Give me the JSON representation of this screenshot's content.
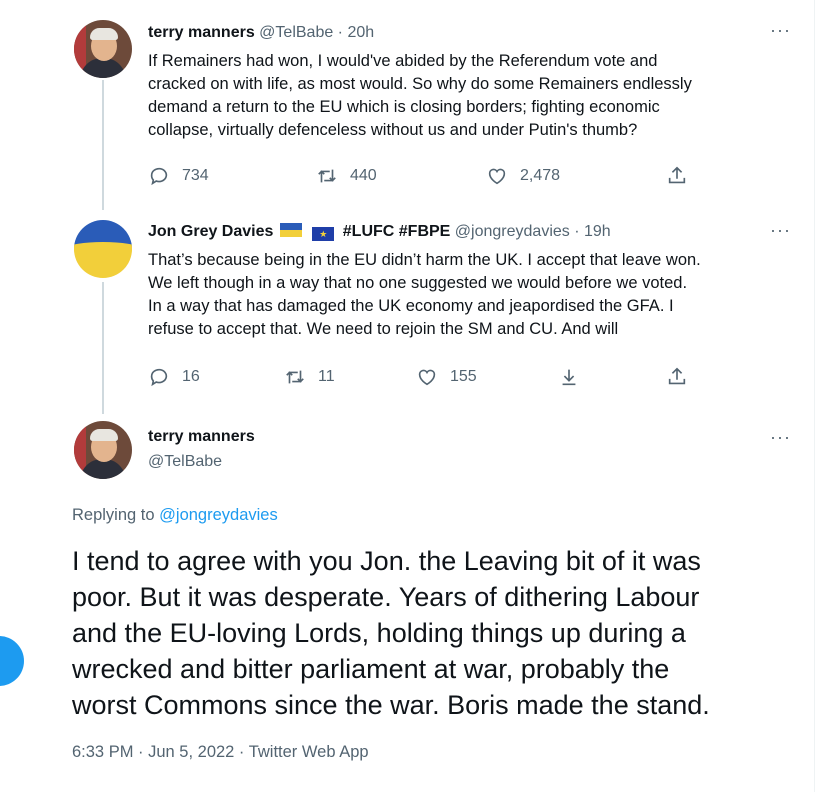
{
  "tweets": [
    {
      "name": "terry manners",
      "handle": "@TelBabe",
      "time": "20h",
      "lines": [
        "If Remainers had won, I would've abided by the Referendum vote and",
        "cracked on with life, as most would. So why do some Remainers endlessly",
        "demand a return to the EU which is closing borders; fighting economic",
        "collapse, virtually defenceless without us and under Putin's thumb?"
      ],
      "replies": "734",
      "retweets": "440",
      "likes": "2,478"
    },
    {
      "name": "Jon Grey Davies",
      "name_suffix": "#LUFC #FBPE",
      "handle": "@jongreydavies",
      "time": "19h",
      "lines": [
        "That’s because being in the EU didn’t harm the UK. I accept that leave won.",
        "We left though in a way that no one suggested we would before we voted.",
        "In a way that has damaged the UK economy and jeapordised the GFA. I",
        "refuse to accept that. We need to rejoin the SM and CU. And will"
      ],
      "replies": "16",
      "retweets": "11",
      "likes": "155"
    }
  ],
  "main_tweet": {
    "name": "terry manners",
    "handle": "@TelBabe",
    "replying_prefix": "Replying to",
    "replying_to": "@jongreydavies",
    "lines": [
      "I tend to agree with you Jon. the Leaving bit of it was",
      "poor. But it was desperate. Years of dithering Labour",
      "and the EU-loving Lords, holding things up during a",
      "wrecked and bitter parliament at war, probably the",
      "worst Commons since the war. Boris made the stand."
    ],
    "timestamp": "6:33 PM · Jun 5, 2022 · Twitter Web App"
  },
  "ui": {
    "more": "···",
    "separator": " · ",
    "eu_flag_glyph": "★"
  },
  "icons": {
    "reply": "reply-icon",
    "retweet": "retweet-icon",
    "like": "heart-icon",
    "share": "share-icon",
    "download": "download-icon",
    "more": "more-icon"
  },
  "colors": {
    "accent": "#1d9bf0",
    "text": "#0f1419",
    "muted": "#536471"
  }
}
